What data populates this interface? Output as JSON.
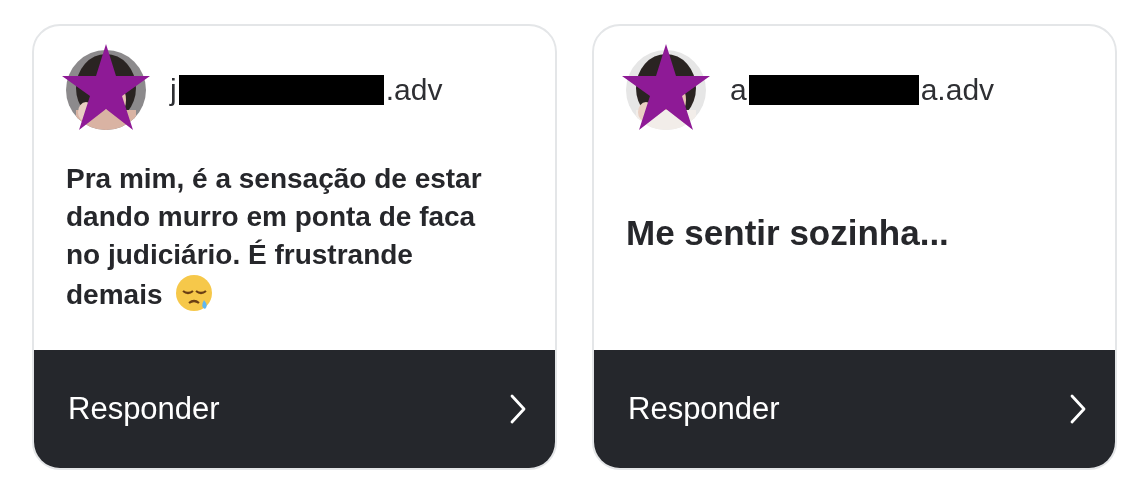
{
  "cards": [
    {
      "username_prefix": "j",
      "username_suffix": ".adv",
      "answer": "Pra mim, é a sensação de estar dando murro em ponta de faca no judiciário. É frustrande demais",
      "kind": "paragraph",
      "emoji": true,
      "button": "Responder"
    },
    {
      "username_prefix": "a",
      "username_suffix": "a.adv",
      "answer": "Me sentir sozinha...",
      "kind": "short",
      "emoji": false,
      "button": "Responder"
    }
  ]
}
